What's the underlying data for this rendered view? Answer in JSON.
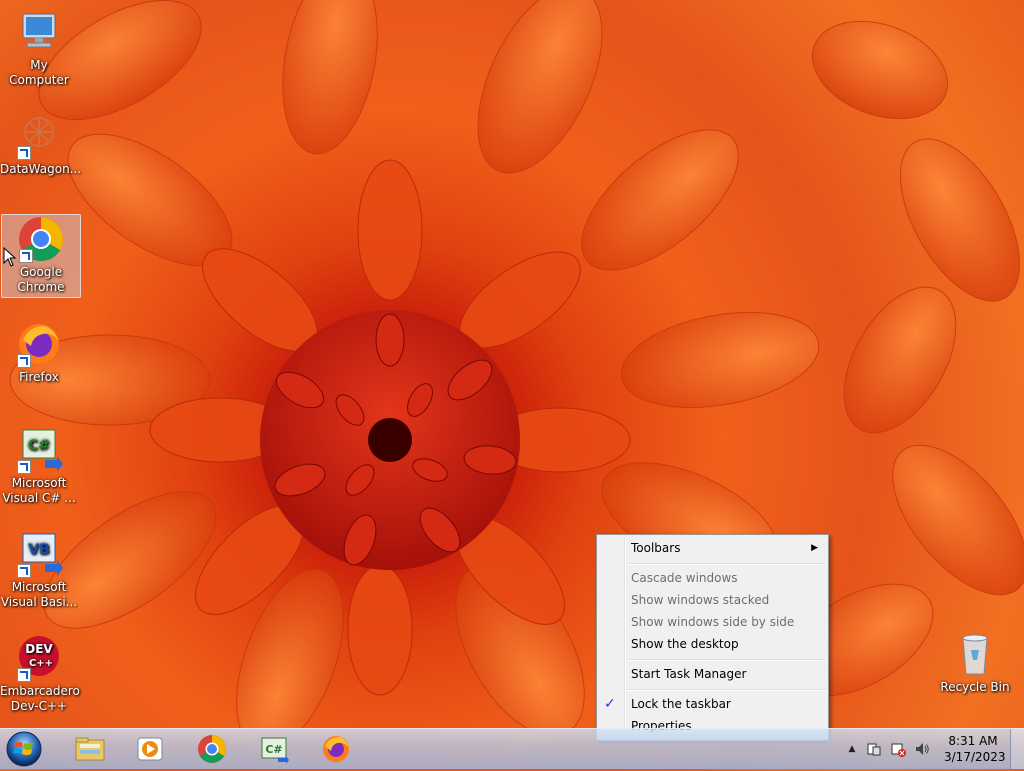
{
  "desktop": {
    "icons": [
      {
        "label": "My Computer",
        "icon": "computer-icon"
      },
      {
        "label": "DataWagon...",
        "icon": "datawagon-icon"
      },
      {
        "label": "Google Chrome",
        "icon": "chrome-icon"
      },
      {
        "label": "Firefox",
        "icon": "firefox-icon"
      },
      {
        "label": "Microsoft Visual C# ...",
        "icon": "visual-csharp-icon"
      },
      {
        "label": "Microsoft Visual Basi...",
        "icon": "visual-basic-icon"
      },
      {
        "label": "Embarcadero Dev-C++",
        "icon": "devcpp-icon"
      },
      {
        "label": "Recycle Bin",
        "icon": "recycle-bin-icon"
      }
    ],
    "devcpp_badge": "DEV",
    "devcpp_badge_sub": "C++",
    "csharp_badge": "C#",
    "vb_badge": "VB"
  },
  "context_menu": {
    "items": [
      {
        "label": "Toolbars",
        "submenu": true,
        "enabled": true
      },
      {
        "label": "Cascade windows",
        "enabled": false
      },
      {
        "label": "Show windows stacked",
        "enabled": false
      },
      {
        "label": "Show windows side by side",
        "enabled": false
      },
      {
        "label": "Show the desktop",
        "enabled": true
      },
      {
        "label": "Start Task Manager",
        "enabled": true
      },
      {
        "label": "Lock the taskbar",
        "enabled": true,
        "checked": true
      },
      {
        "label": "Properties",
        "enabled": true
      }
    ],
    "submenu_arrow": "▶",
    "check_mark": "✓"
  },
  "taskbar": {
    "start_icon": "windows-logo-icon",
    "pinned": [
      {
        "name": "windows-explorer-icon"
      },
      {
        "name": "media-player-icon"
      },
      {
        "name": "chrome-icon"
      },
      {
        "name": "visual-csharp-icon",
        "badge": "C#"
      },
      {
        "name": "firefox-icon"
      }
    ],
    "tray": {
      "arrow": "▲",
      "time": "8:31 AM",
      "date": "3/17/2023"
    }
  },
  "colors": {
    "wallpaper_accent": "#e85a18",
    "menu_bg": "#f0f0f0",
    "taskbar_bg": "#b4c8e6"
  }
}
